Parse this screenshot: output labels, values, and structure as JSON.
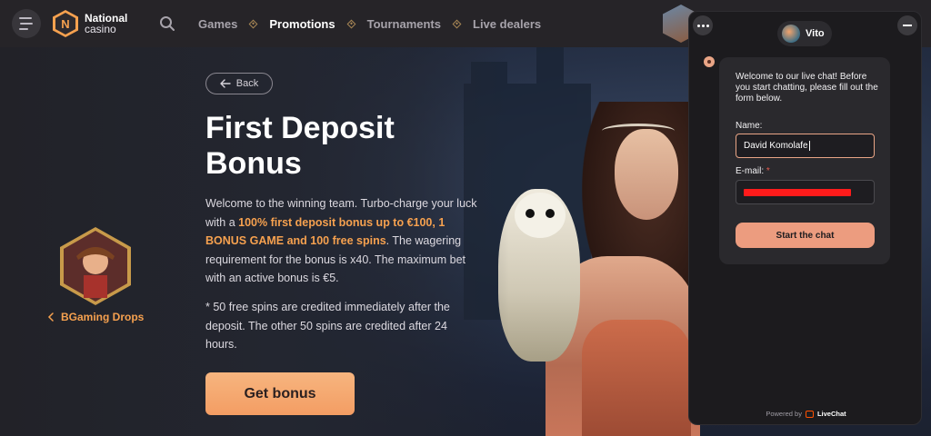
{
  "header": {
    "logo": {
      "line1": "National",
      "line2": "casino",
      "letter": "N"
    },
    "nav": [
      {
        "label": "Games",
        "active": false
      },
      {
        "label": "Promotions",
        "active": true
      },
      {
        "label": "Tournaments",
        "active": false
      },
      {
        "label": "Live dealers",
        "active": false
      }
    ]
  },
  "hero": {
    "back_label": "Back",
    "title": "First Deposit Bonus",
    "desc_1": "Welcome to the winning team. Turbo-charge your luck with a ",
    "desc_highlight": "100% first deposit bonus up to €100, 1 BONUS GAME and 100 free spins",
    "desc_2": ". The wagering requirement for the bonus is x40. The maximum bet with an active bonus is €5.",
    "note": "* 50 free spins are credited immediately after the deposit. The other 50 spins are credited after 24 hours.",
    "cta_label": "Get bonus",
    "drops_label": "BGaming Drops"
  },
  "chat": {
    "agent_name": "Vito",
    "welcome": "Welcome to our live chat! Before you start chatting, please fill out the form below.",
    "name_label": "Name:",
    "name_value": "David Komolafe",
    "email_label": "E-mail:",
    "required_mark": "*",
    "start_label": "Start the chat",
    "powered_prefix": "Powered by",
    "powered_brand": "LiveChat"
  },
  "colors": {
    "accent": "#f6a14f",
    "cta": "#f39d63",
    "chat_button": "#ec9c7f",
    "redaction": "#ff1b1b"
  }
}
